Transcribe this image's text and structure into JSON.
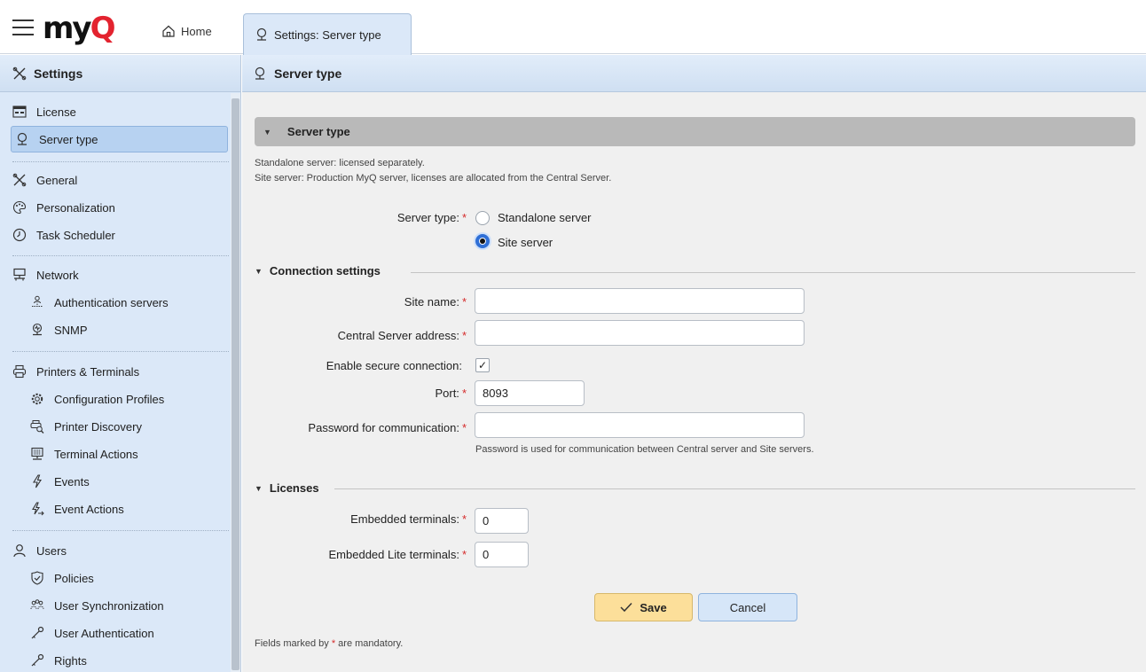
{
  "topbar": {
    "logo_my": "my",
    "logo_q": "Q",
    "home_label": "Home",
    "tab_label": "Settings: Server type"
  },
  "sidebar": {
    "title": "Settings",
    "items": [
      {
        "label": "License",
        "icon": "license-icon"
      },
      {
        "label": "Server type",
        "icon": "server-type-icon",
        "active": true
      },
      {
        "label": "General",
        "icon": "tools-icon"
      },
      {
        "label": "Personalization",
        "icon": "palette-icon"
      },
      {
        "label": "Task Scheduler",
        "icon": "clock-icon"
      },
      {
        "label": "Network",
        "icon": "network-icon"
      },
      {
        "label": "Authentication servers",
        "icon": "auth-server-icon"
      },
      {
        "label": "SNMP",
        "icon": "snmp-icon"
      },
      {
        "label": "Printers & Terminals",
        "icon": "printer-icon"
      },
      {
        "label": "Configuration Profiles",
        "icon": "config-gear-icon"
      },
      {
        "label": "Printer Discovery",
        "icon": "printer-search-icon"
      },
      {
        "label": "Terminal Actions",
        "icon": "terminal-icon"
      },
      {
        "label": "Events",
        "icon": "lightning-icon"
      },
      {
        "label": "Event Actions",
        "icon": "lightning-arrow-icon"
      },
      {
        "label": "Users",
        "icon": "user-icon"
      },
      {
        "label": "Policies",
        "icon": "shield-icon"
      },
      {
        "label": "User Synchronization",
        "icon": "users-sync-icon"
      },
      {
        "label": "User Authentication",
        "icon": "key-icon"
      },
      {
        "label": "Rights",
        "icon": "key-icon"
      }
    ]
  },
  "main": {
    "title": "Server type",
    "section_title": "Server type",
    "desc_line1": "Standalone server: licensed separately.",
    "desc_line2": "Site server: Production MyQ server, licenses are allocated from the Central Server.",
    "server_type_label": "Server type:",
    "option_standalone": "Standalone server",
    "option_site": "Site server",
    "selected_option": "Site server",
    "connection_group": "Connection settings",
    "site_name_label": "Site name:",
    "site_name_value": "",
    "central_address_label": "Central Server address:",
    "central_address_value": "",
    "secure_label": "Enable secure connection:",
    "secure_checked": true,
    "port_label": "Port:",
    "port_value": "8093",
    "password_label": "Password for communication:",
    "password_value": "",
    "password_help": "Password is used for communication between Central server and Site servers.",
    "licenses_group": "Licenses",
    "embedded_label": "Embedded terminals:",
    "embedded_value": "0",
    "embedded_lite_label": "Embedded Lite terminals:",
    "embedded_lite_value": "0",
    "save_label": "Save",
    "cancel_label": "Cancel",
    "footnote_prefix": "Fields marked by",
    "footnote_star": "*",
    "footnote_suffix": "are mandatory.",
    "required_mark": "*"
  },
  "colors": {
    "accent": "#2f6fd6",
    "required": "#d52b2b",
    "save_button": "#fcdf9a",
    "sidebar_bg": "#dbe8f8"
  }
}
